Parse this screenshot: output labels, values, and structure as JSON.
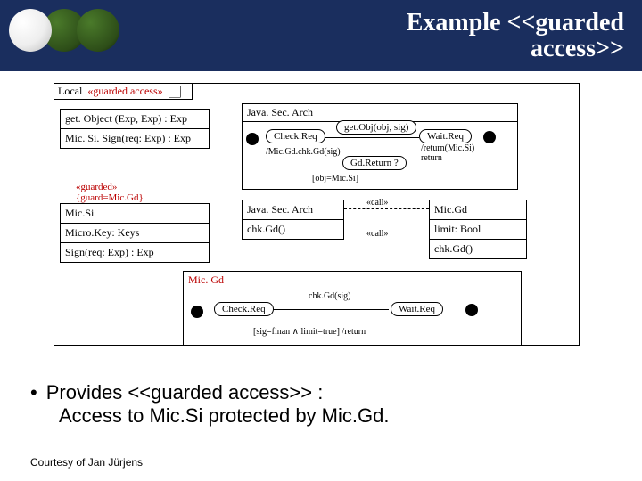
{
  "header": {
    "title": "Example <<guarded\naccess>>"
  },
  "diagram": {
    "local_tab": {
      "label": "Local",
      "stereotype": "«guarded access»"
    },
    "left_block_1": {
      "row1": "get. Object (Exp, Exp) : Exp",
      "row2": "Mic. Si. Sign(req: Exp) : Exp"
    },
    "left_block_2_stereotype": "«guarded»\n{guard=Mic.Gd}",
    "left_block_2": {
      "row1": "Mic.Si",
      "row2": "Micro.Key: Keys",
      "row3": "Sign(req: Exp) : Exp"
    },
    "jsa": {
      "title": "Java. Sec. Arch",
      "check_req": "Check.Req",
      "get_obj": "get.Obj(obj, sig)",
      "wait_req": "Wait.Req",
      "t1": "/Mic.Gd.chk.Gd(sig)",
      "t2": "/return(Mic.Si)\nreturn",
      "t3": "Gd.Return ?",
      "t4": "[obj=Mic.Si]"
    },
    "mid_jsa": {
      "title": "Java. Sec. Arch",
      "method": "chk.Gd()"
    },
    "mid_micgd": {
      "title": "Mic.Gd",
      "limit": "limit: Bool",
      "method": "chk.Gd()"
    },
    "call_label": "«call»",
    "micgd_frame": {
      "title": "Mic. Gd",
      "check_req": "Check.Req",
      "top_label": "chk.Gd(sig)",
      "wait_req": "Wait.Req",
      "bottom_label": "[sig=finan ∧  limit=true]   /return"
    }
  },
  "bullet": {
    "line1": "Provides <<guarded access>> :",
    "line2": "Access to Mic.Si protected by Mic.Gd."
  },
  "footer": "Courtesy of Jan Jürjens"
}
